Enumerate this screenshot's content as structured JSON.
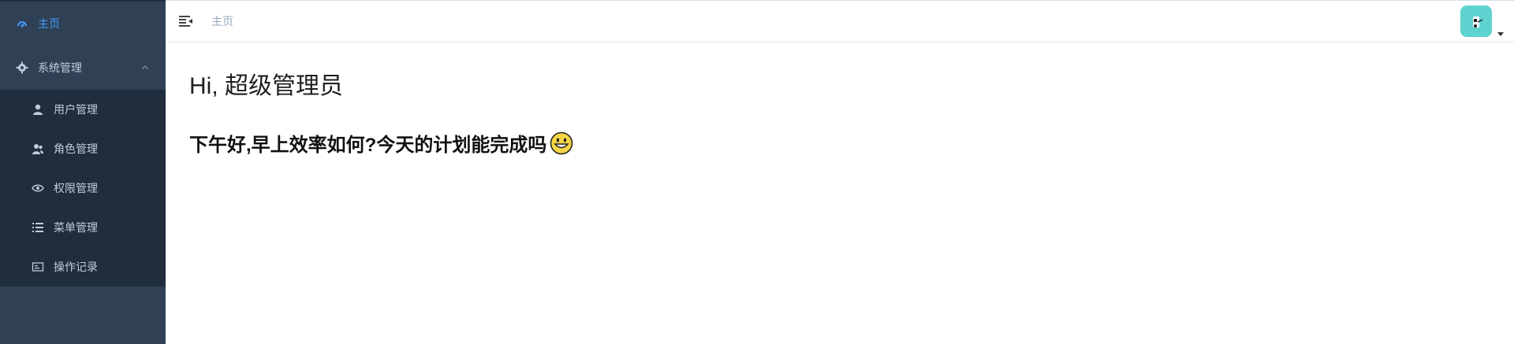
{
  "sidebar": {
    "home": {
      "label": "主页",
      "icon": "dashboard-icon"
    },
    "group": {
      "label": "系统管理",
      "icon": "gear-icon",
      "expanded": true
    },
    "items": [
      {
        "label": "用户管理",
        "icon": "user-icon"
      },
      {
        "label": "角色管理",
        "icon": "peoples-icon"
      },
      {
        "label": "权限管理",
        "icon": "eye-icon"
      },
      {
        "label": "菜单管理",
        "icon": "list-icon"
      },
      {
        "label": "操作记录",
        "icon": "log-icon"
      }
    ]
  },
  "navbar": {
    "breadcrumb": "主页",
    "avatar_icon": "avatar-icon"
  },
  "content": {
    "hi": "Hi, 超级管理员",
    "greeting": "下午好,早上效率如何?今天的计划能完成吗"
  },
  "colors": {
    "sidebar_bg": "#304156",
    "submenu_bg": "#1f2d3d",
    "active": "#409eff",
    "menu_text": "#bfcbd9",
    "avatar_bg": "#5fd3d0"
  }
}
